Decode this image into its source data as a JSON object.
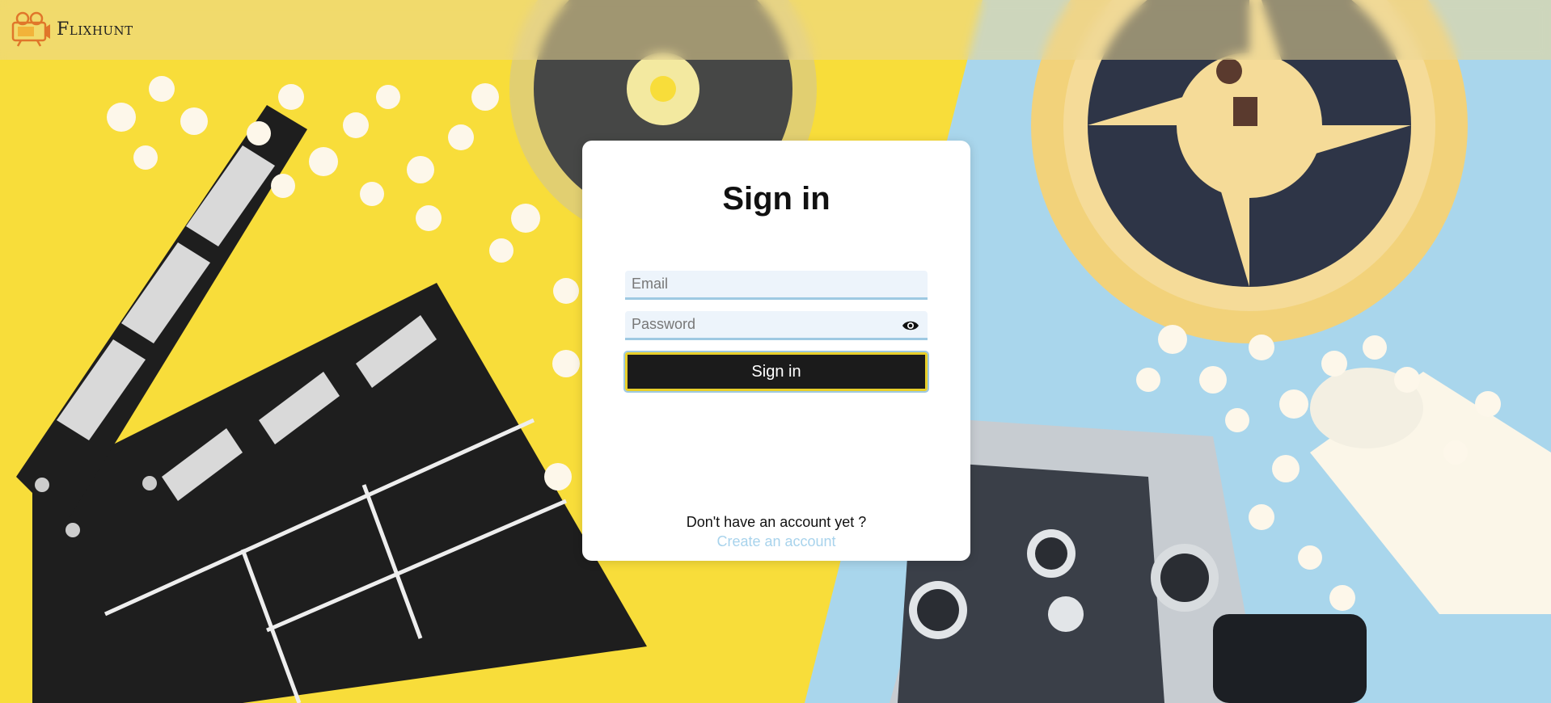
{
  "header": {
    "brand_name": "Flixhunt"
  },
  "signin_card": {
    "title": "Sign in",
    "email_placeholder": "Email",
    "email_value": "",
    "password_placeholder": "Password",
    "password_value": "",
    "submit_label": "Sign in",
    "no_account_text": "Don't have an account yet ?",
    "create_account_link": "Create an account"
  },
  "colors": {
    "background_left": "#f8dd3a",
    "background_right": "#a9d6ec",
    "button": "#1b1b1b",
    "button_border": "#e8cf2a",
    "link": "#a8d3ec",
    "input_bg": "#edf4fb",
    "input_underline": "#9ec9e2"
  },
  "icons": {
    "logo": "film-projector-logo",
    "password_toggle": "eye-icon"
  }
}
